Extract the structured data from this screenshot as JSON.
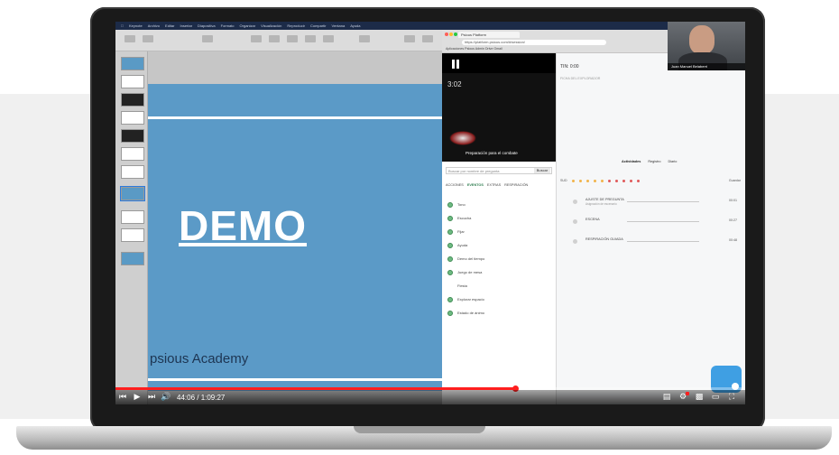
{
  "menubar": {
    "items": [
      "Keynote",
      "Archivo",
      "Editar",
      "Insertar",
      "Diapositiva",
      "Formato",
      "Organizar",
      "Visualización",
      "Reproducir",
      "Compartir",
      "Ventana",
      "Ayuda"
    ]
  },
  "slide": {
    "title": "DEMO",
    "footer": "psious Academy"
  },
  "browser": {
    "tab_title": "Psious Platform",
    "url": "https://platform.psious.com/#/session/",
    "bookmarks": "Aplicaciones   Psious Admin   Drive   Gmail"
  },
  "vr_session": {
    "time": "3:02",
    "caption": "Preparación para el combate",
    "search_placeholder": "Buscar por nombre de pregunta",
    "search_button": "Buscar",
    "filters": [
      "ACCIONES",
      "EVENTOS",
      "EXTRAS",
      "RESPIRACIÓN"
    ],
    "rules": [
      {
        "label": "Tono",
        "checked": true
      },
      {
        "label": "Escucha",
        "checked": true
      },
      {
        "label": "Fijar",
        "checked": true
      },
      {
        "label": "Ayuda",
        "checked": true
      },
      {
        "label": "Demo del tiempo",
        "checked": true
      },
      {
        "label": "Juego de mesa",
        "checked": true
      },
      {
        "label": "Fiesta",
        "checked": false
      },
      {
        "label": "Explorar espacio",
        "checked": true
      },
      {
        "label": "Estado de ánimo",
        "checked": true
      }
    ]
  },
  "right_panel": {
    "header": "TIN: 0:00",
    "sub": "FICHA DEL EXPLORADOR",
    "tabs": [
      "Actividades",
      "Registro",
      "Diario"
    ],
    "score_label": "SUD",
    "score_action": "Guardar",
    "timeline": [
      {
        "label": "AJUSTE DE PREGUNTA",
        "sub": "Asignación de escenario",
        "value": "00:01"
      },
      {
        "label": "ESCENA",
        "sub": "",
        "value": "00:27"
      },
      {
        "label": "RESPIRACIÓN GUIADA",
        "sub": "",
        "value": "00:48"
      }
    ]
  },
  "webcam": {
    "name": "Juan Manuel Belaberri"
  },
  "player": {
    "time": "44:06 / 1:09:27",
    "progress_fraction": 0.635,
    "buffer_fraction": 0.66
  }
}
